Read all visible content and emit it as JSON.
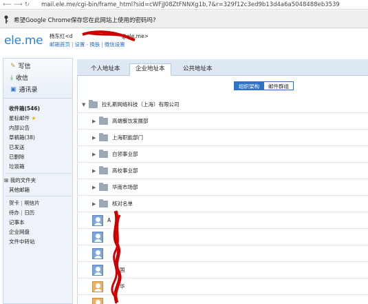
{
  "browser": {
    "url": "mail.ele.me/cgi-bin/frame_html?sid=cWFjJ08ZtFNNXg1b,7&r=329f12c3ed9b13d4a6a5048488eb3539"
  },
  "password_bar": {
    "message": "希望Google Chrome保存您在此网站上使用的密码吗?"
  },
  "header": {
    "logo": "ele.me",
    "user_line": "杨东红<d",
    "user_line_suffix": "@ele.me>",
    "links": [
      "邮箱首页",
      "设置",
      "换肤",
      "微信设置"
    ]
  },
  "sidebar": {
    "actions": [
      {
        "label": "写信",
        "icon": "pencil-icon"
      },
      {
        "label": "收信",
        "icon": "inbox-icon"
      },
      {
        "label": "通讯录",
        "icon": "contacts-icon"
      }
    ],
    "folders": [
      "收件箱(546)",
      "星标邮件",
      "内部公告",
      "草稿箱(38)",
      "已发送",
      "已删除",
      "垃圾箱"
    ],
    "my_folders": "我的文件夹",
    "other_mailboxes": "其他邮箱",
    "tools_row1": [
      "贺卡",
      "明信片"
    ],
    "tools_row2": [
      "待办",
      "日历"
    ],
    "tools": [
      "记事本",
      "企业网盘",
      "文件中转站"
    ]
  },
  "tabs": [
    "个人地址本",
    "企业地址本",
    "公共地址本"
  ],
  "active_tab": 1,
  "segmented": {
    "on": "组织架构",
    "off": "邮件群组"
  },
  "org_root": "拉扎斯网络科技（上海）有限公司",
  "departments": [
    "高端餐饮发展部",
    "上海职能部门",
    "白领事业部",
    "高校事业部",
    "华南市场部",
    "核对名单"
  ],
  "contacts": [
    {
      "name": "A",
      "avatar": "blue"
    },
    {
      "name": "",
      "avatar": "blue"
    },
    {
      "name": "",
      "avatar": "blue"
    },
    {
      "name": "国",
      "avatar": "blue"
    },
    {
      "name": "华",
      "avatar": "orange"
    },
    {
      "name": "",
      "avatar": "orange"
    }
  ],
  "colors": {
    "accent": "#2f72c8",
    "logo": "#2a82d6",
    "redaction": "#cc0000"
  }
}
